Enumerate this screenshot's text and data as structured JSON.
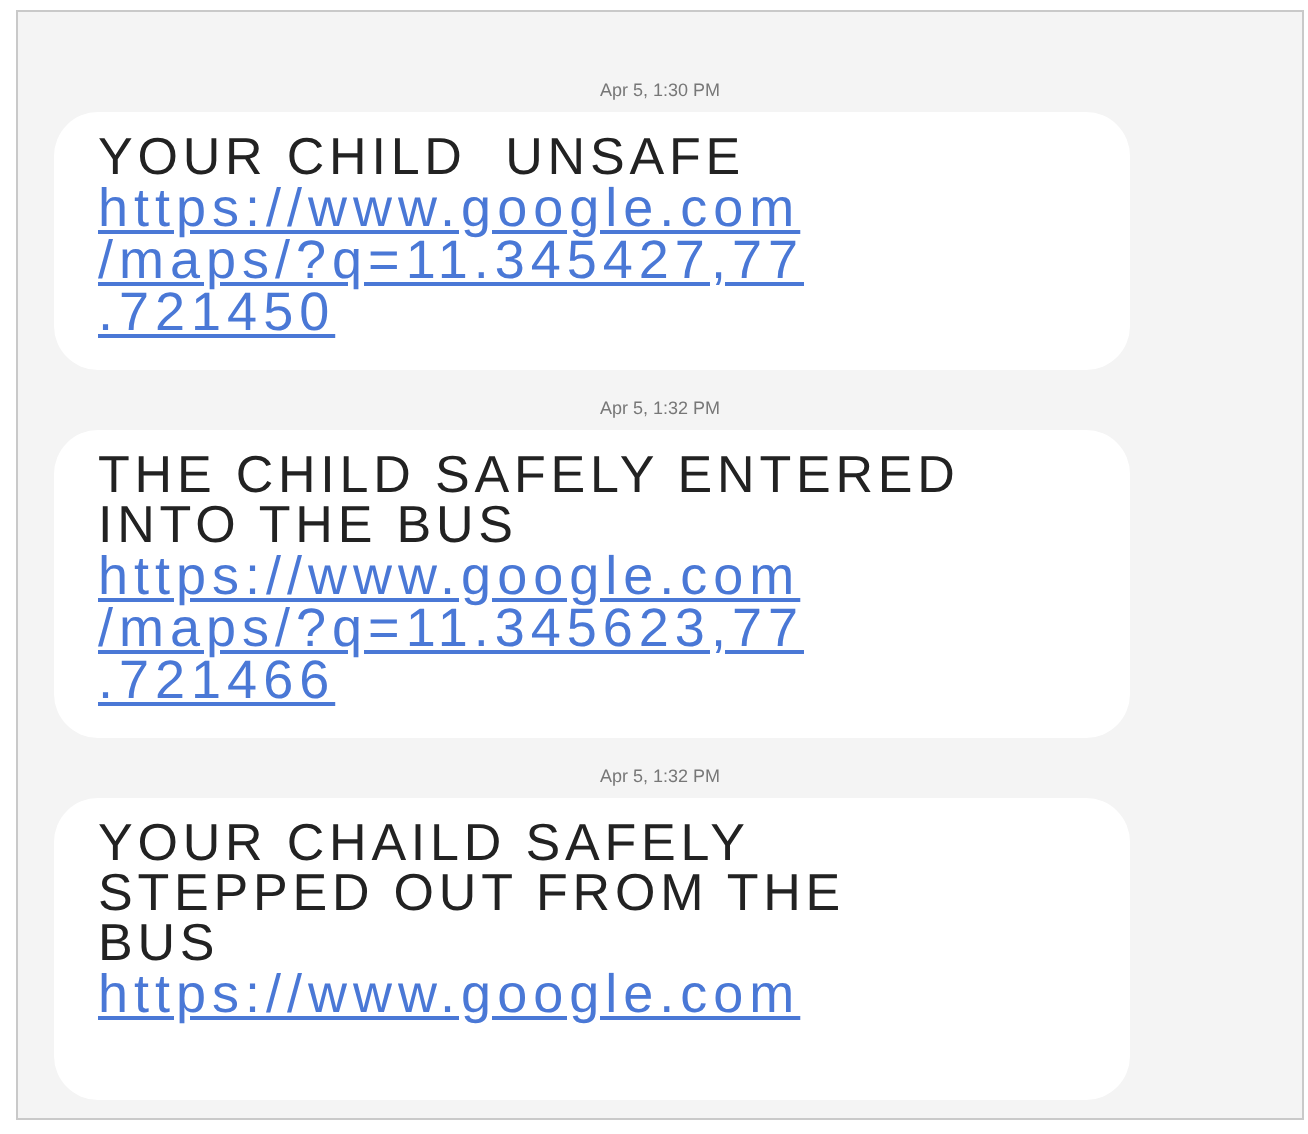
{
  "messages": [
    {
      "time": "Apr 5, 1:30 PM",
      "text_lines": [
        "YOUR CHILD  UNSAFE"
      ],
      "link_lines": [
        "https://www.google.com",
        "/maps/?q=11.345427,77",
        ".721450"
      ]
    },
    {
      "time": "Apr 5, 1:32 PM",
      "text_lines": [
        "THE CHILD SAFELY ENTERED",
        "INTO THE BUS"
      ],
      "link_lines": [
        "https://www.google.com",
        "/maps/?q=11.345623,77",
        ".721466"
      ]
    },
    {
      "time": "Apr 5, 1:32 PM",
      "text_lines": [
        "YOUR CHAILD SAFELY",
        "STEPPED OUT FROM THE",
        "BUS"
      ],
      "link_lines": [
        "https://www.google.com"
      ]
    }
  ]
}
